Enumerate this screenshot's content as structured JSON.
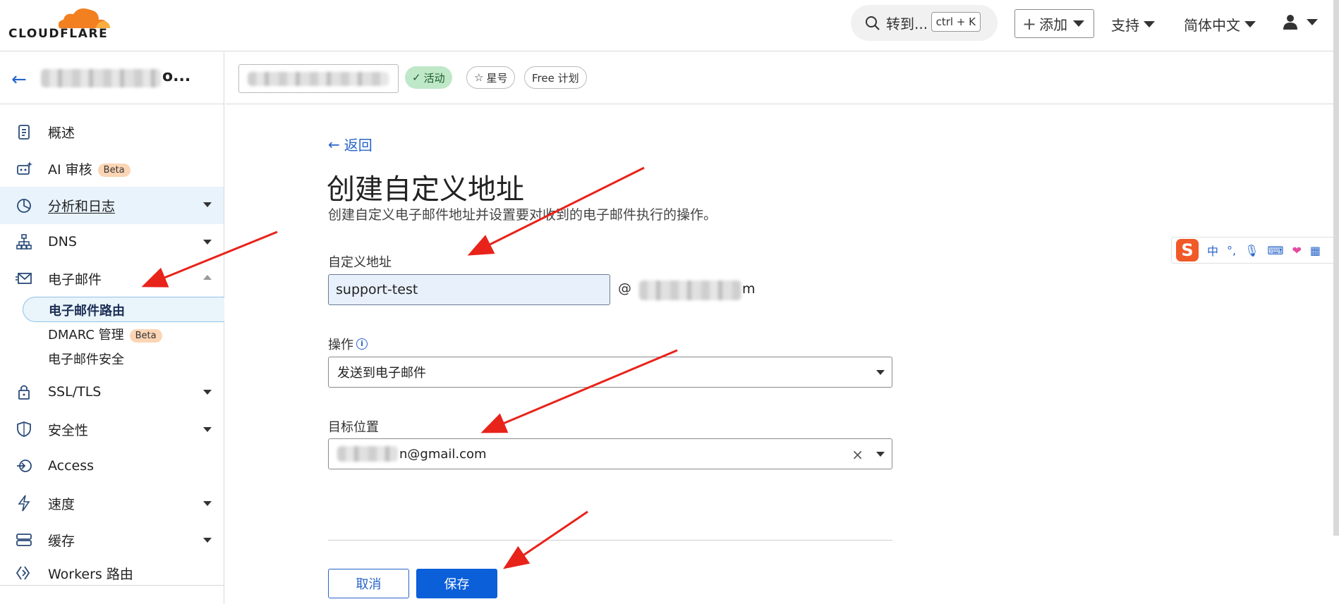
{
  "brand": {
    "logo_text": "CLOUDFLARE",
    "accent": "#f38020"
  },
  "topbar": {
    "search_label": "转到...",
    "shortcut": "ctrl + K",
    "add_label": "添加",
    "support_label": "支持",
    "language_label": "简体中文"
  },
  "sidebar": {
    "items": [
      {
        "label": "概述",
        "icon": "clipboard-icon"
      },
      {
        "label": "AI 审核",
        "badge": "Beta",
        "icon": "robot-icon"
      },
      {
        "label": "分析和日志",
        "icon": "pie-chart-icon"
      },
      {
        "label": "DNS",
        "icon": "network-icon"
      },
      {
        "label": "电子邮件",
        "icon": "mail-icon"
      },
      {
        "label": "SSL/TLS",
        "icon": "lock-icon"
      },
      {
        "label": "安全性",
        "icon": "shield-icon"
      },
      {
        "label": "Access",
        "icon": "access-icon"
      },
      {
        "label": "速度",
        "icon": "bolt-icon"
      },
      {
        "label": "缓存",
        "icon": "storage-icon"
      },
      {
        "label": "Workers 路由",
        "icon": "workers-icon"
      }
    ],
    "email_sub": [
      {
        "label": "电子邮件路由"
      },
      {
        "label": "DMARC 管理",
        "badge": "Beta"
      },
      {
        "label": "电子邮件安全"
      }
    ]
  },
  "zonebar": {
    "status": "活动",
    "star_label": "星号",
    "plan": "Free 计划"
  },
  "main": {
    "back_label": "返回",
    "title": "创建自定义地址",
    "description": "创建自定义电子邮件地址并设置要对收到的电子邮件执行的操作。",
    "custom_address_label": "自定义地址",
    "custom_address_value": "support-test",
    "at_sign": "@",
    "domain_tail": "m",
    "action_label": "操作",
    "action_value": "发送到电子邮件",
    "destination_label": "目标位置",
    "destination_value": "n@gmail.com",
    "cancel_label": "取消",
    "save_label": "保存"
  },
  "ime": {
    "lang": "中",
    "punct": "°,"
  },
  "colors": {
    "primary": "#0b5fd9",
    "link": "#2563c9",
    "active_badge": "#bfe8c8",
    "beta_badge": "#fbd5b4",
    "annotation": "#e8231a"
  }
}
